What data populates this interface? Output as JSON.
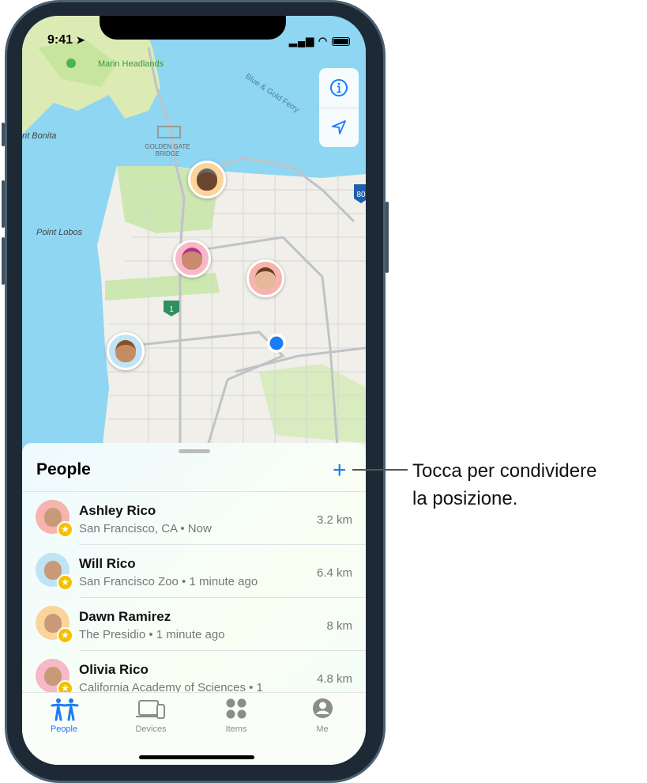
{
  "status_bar": {
    "time": "9:41"
  },
  "map": {
    "labels": {
      "marin": "Marin Headlands",
      "ferry": "Blue & Gold Ferry",
      "bonita": "nt Bonita",
      "bridge1": "GOLDEN GATE",
      "bridge2": "BRIDGE",
      "lobos": "Point Lobos",
      "hwy1": "1",
      "i80": "80"
    },
    "controls": [
      "info-icon",
      "location-arrow-icon"
    ],
    "user_location_color": "#1a7cf5"
  },
  "sheet": {
    "title": "People",
    "add_label": "+",
    "people": [
      {
        "name": "Ashley Rico",
        "subtitle": "San Francisco, CA • Now",
        "distance": "3.2 km",
        "color": "#f7b3ad"
      },
      {
        "name": "Will Rico",
        "subtitle": "San Francisco Zoo • 1 minute ago",
        "distance": "6.4 km",
        "color": "#bfe4f5"
      },
      {
        "name": "Dawn Ramirez",
        "subtitle": "The Presidio • 1 minute ago",
        "distance": "8 km",
        "color": "#fbd49a"
      },
      {
        "name": "Olivia Rico",
        "subtitle": "California Academy of Sciences • 1",
        "distance": "4.8 km",
        "color": "#f7b8c8"
      }
    ]
  },
  "tabs": [
    {
      "label": "People",
      "active": true
    },
    {
      "label": "Devices",
      "active": false
    },
    {
      "label": "Items",
      "active": false
    },
    {
      "label": "Me",
      "active": false
    }
  ],
  "accent": "#1a7cf5",
  "callout": {
    "line1": "Tocca per condividere",
    "line2": "la posizione."
  }
}
